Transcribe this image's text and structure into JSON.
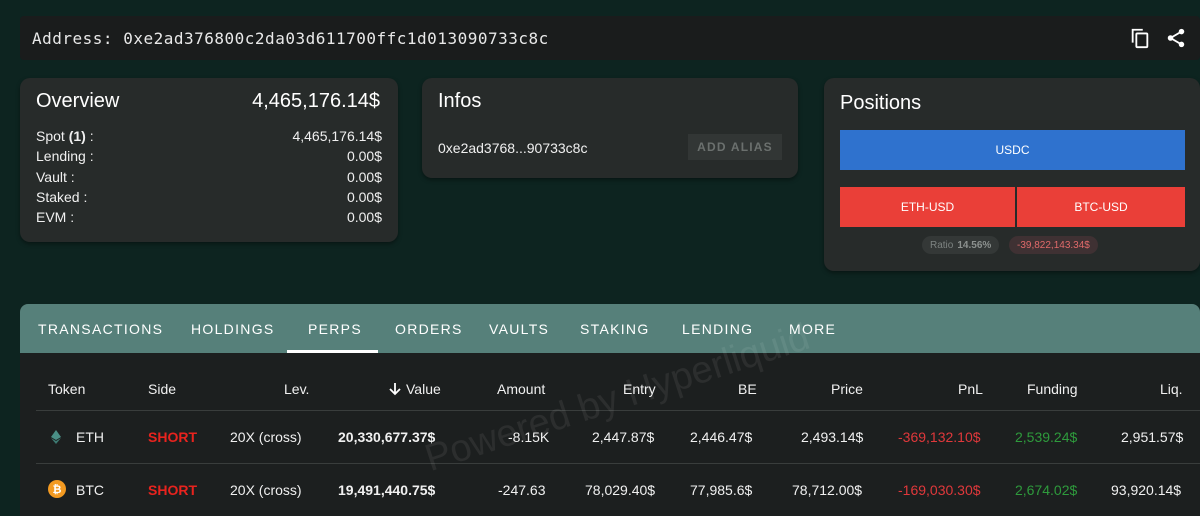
{
  "address_bar": {
    "label": "Address: 0xe2ad376800c2da03d611700ffc1d013090733c8c",
    "copy_icon": "copy-icon",
    "share_icon": "share-icon"
  },
  "overview": {
    "title": "Overview",
    "total": "4,465,176.14$",
    "rows": [
      {
        "label_pre": "Spot ",
        "label_bold": "(1)",
        "label_post": " :",
        "value": "4,465,176.14$"
      },
      {
        "label_pre": "Lending :",
        "label_bold": "",
        "label_post": "",
        "value": "0.00$"
      },
      {
        "label_pre": "Vault :",
        "label_bold": "",
        "label_post": "",
        "value": "0.00$"
      },
      {
        "label_pre": "Staked :",
        "label_bold": "",
        "label_post": "",
        "value": "0.00$"
      },
      {
        "label_pre": "EVM :",
        "label_bold": "",
        "label_post": "",
        "value": "0.00$"
      }
    ]
  },
  "infos": {
    "title": "Infos",
    "short_address": "0xe2ad3768...90733c8c",
    "alias_button": "ADD ALIAS"
  },
  "positions": {
    "title": "Positions",
    "usdc": "USDC",
    "eth": "ETH-USD",
    "btc": "BTC-USD",
    "ratio_label": "Ratio",
    "ratio_value": "14.56%",
    "pnl": "-39,822,143.34$",
    "colors": {
      "long": "#2f72ce",
      "short": "#ea3f38"
    }
  },
  "tabs": [
    "TRANSACTIONS",
    "HOLDINGS",
    "PERPS",
    "ORDERS",
    "VAULTS",
    "STAKING",
    "LENDING",
    "MORE"
  ],
  "active_tab": "PERPS",
  "table": {
    "headers": {
      "token": "Token",
      "side": "Side",
      "lev": "Lev.",
      "value": "Value",
      "amount": "Amount",
      "entry": "Entry",
      "be": "BE",
      "price": "Price",
      "pnl": "PnL",
      "funding": "Funding",
      "liq": "Liq."
    },
    "rows": [
      {
        "icon": "ethereum-icon",
        "token": "ETH",
        "side": "SHORT",
        "lev": "20X (cross)",
        "value": "20,330,677.37$",
        "amount": "-8.15K",
        "entry": "2,447.87$",
        "be": "2,446.47$",
        "price": "2,493.14$",
        "pnl": "-369,132.10$",
        "funding": "2,539.24$",
        "liq": "2,951.57$"
      },
      {
        "icon": "bitcoin-icon",
        "token": "BTC",
        "side": "SHORT",
        "lev": "20X (cross)",
        "value": "19,491,440.75$",
        "amount": "-247.63",
        "entry": "78,029.40$",
        "be": "77,985.6$",
        "price": "78,712.00$",
        "pnl": "-169,030.30$",
        "funding": "2,674.02$",
        "liq": "93,920.14$"
      }
    ]
  },
  "watermark": "Powered by Hyperliquid"
}
